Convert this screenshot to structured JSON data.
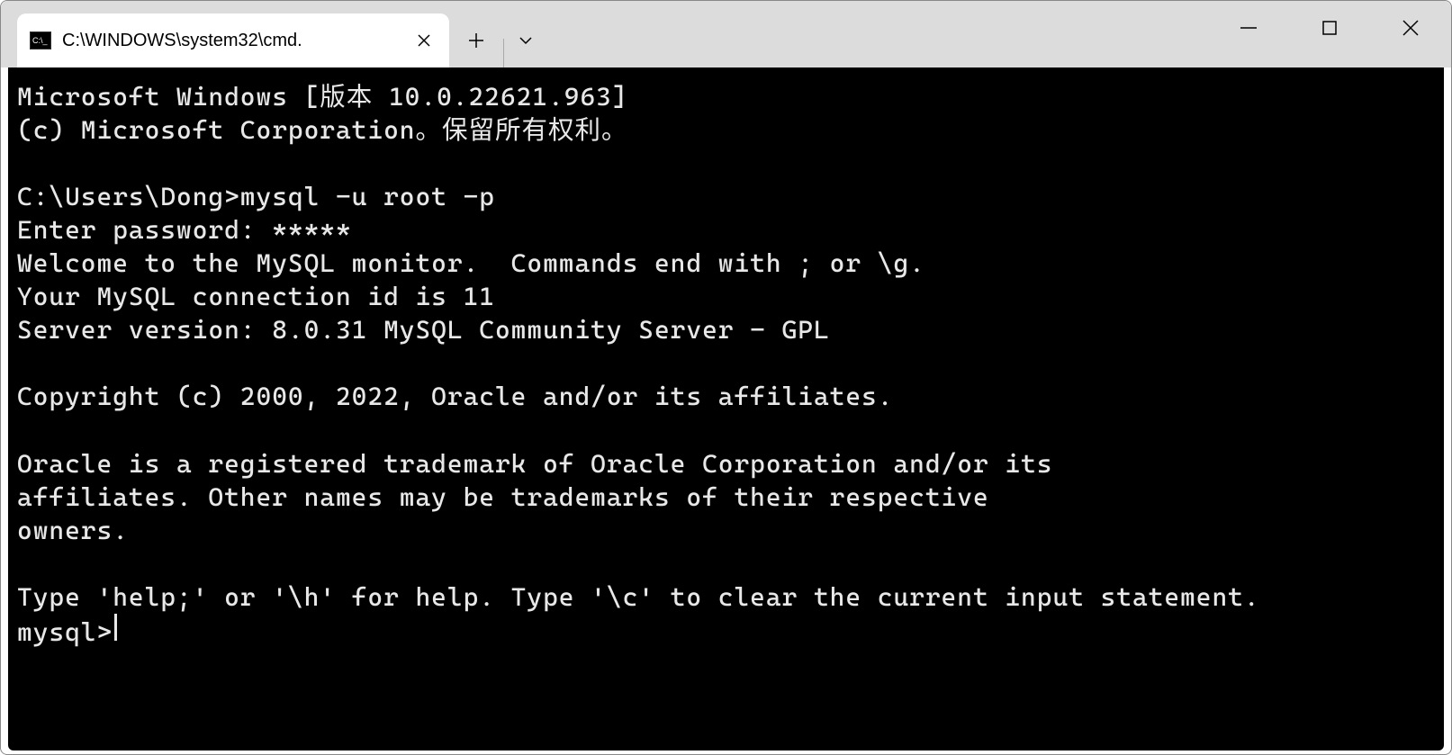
{
  "titlebar": {
    "tab": {
      "icon_label": "C:\\_",
      "title": "C:\\WINDOWS\\system32\\cmd."
    }
  },
  "terminal": {
    "lines": "Microsoft Windows [版本 10.0.22621.963]\n(c) Microsoft Corporation。保留所有权利。\n\nC:\\Users\\Dong>mysql -u root -p\nEnter password: *****\nWelcome to the MySQL monitor.  Commands end with ; or \\g.\nYour MySQL connection id is 11\nServer version: 8.0.31 MySQL Community Server - GPL\n\nCopyright (c) 2000, 2022, Oracle and/or its affiliates.\n\nOracle is a registered trademark of Oracle Corporation and/or its\naffiliates. Other names may be trademarks of their respective\nowners.\n\nType 'help;' or '\\h' for help. Type '\\c' to clear the current input statement.\n",
    "prompt": "mysql> "
  }
}
